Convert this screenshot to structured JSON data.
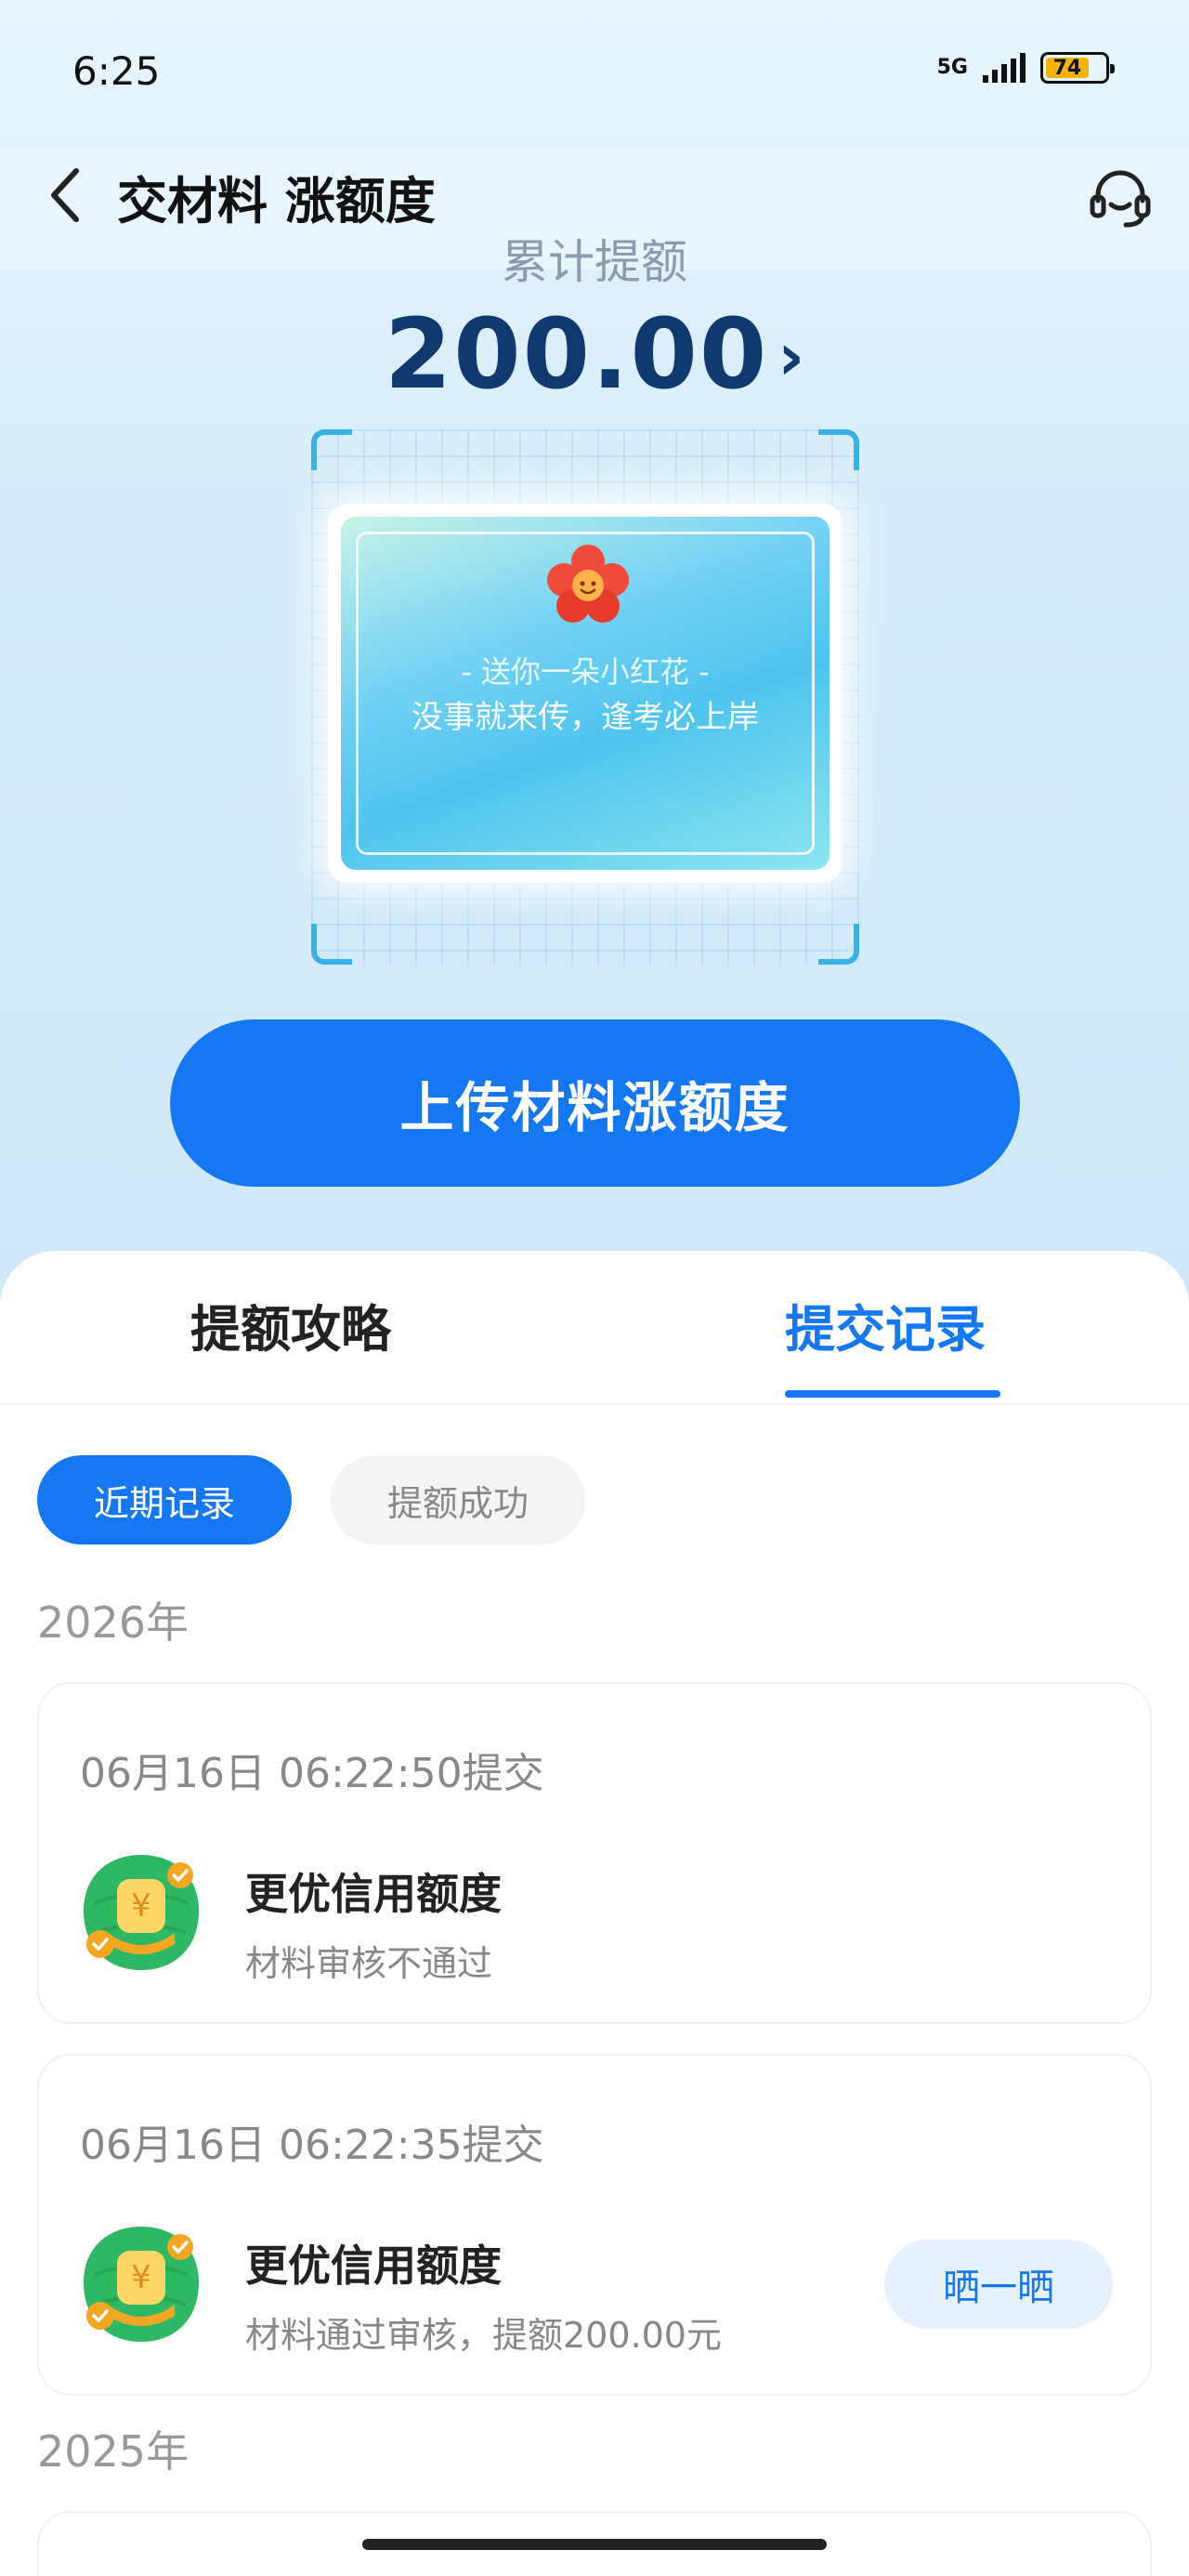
{
  "status_bar": {
    "time": "6:25",
    "network": "5G",
    "battery": "74",
    "battery_level_percent": 74
  },
  "nav": {
    "title": "交材料 涨额度",
    "back_icon": "chevron-left-icon",
    "support_icon": "headset-icon"
  },
  "summary": {
    "label": "累计提额",
    "amount": "200.00",
    "chevron": "›"
  },
  "card": {
    "icon": "red-flower-icon",
    "subtitle": "- 送你一朵小红花 -",
    "message": "没事就来传，逢考必上岸"
  },
  "upload_button": "上传材料涨额度",
  "tabs": [
    {
      "label": "提额攻略",
      "active": false
    },
    {
      "label": "提交记录",
      "active": true
    }
  ],
  "filters": [
    {
      "label": "近期记录",
      "active": true
    },
    {
      "label": "提额成功",
      "active": false
    }
  ],
  "years": [
    "2026年",
    "2025年"
  ],
  "records": [
    {
      "time": "06月16日 06:22:50提交",
      "title": "更优信用额度",
      "status": "材料审核不通过",
      "icon": "credit-money-icon"
    },
    {
      "time": "06月16日 06:22:35提交",
      "title": "更优信用额度",
      "status": "材料通过审核，提额200.00元",
      "icon": "credit-money-icon",
      "action": "晒一晒"
    }
  ],
  "colors": {
    "primary": "#1677f3",
    "amount": "#10396f",
    "background": "#d9eefb"
  }
}
